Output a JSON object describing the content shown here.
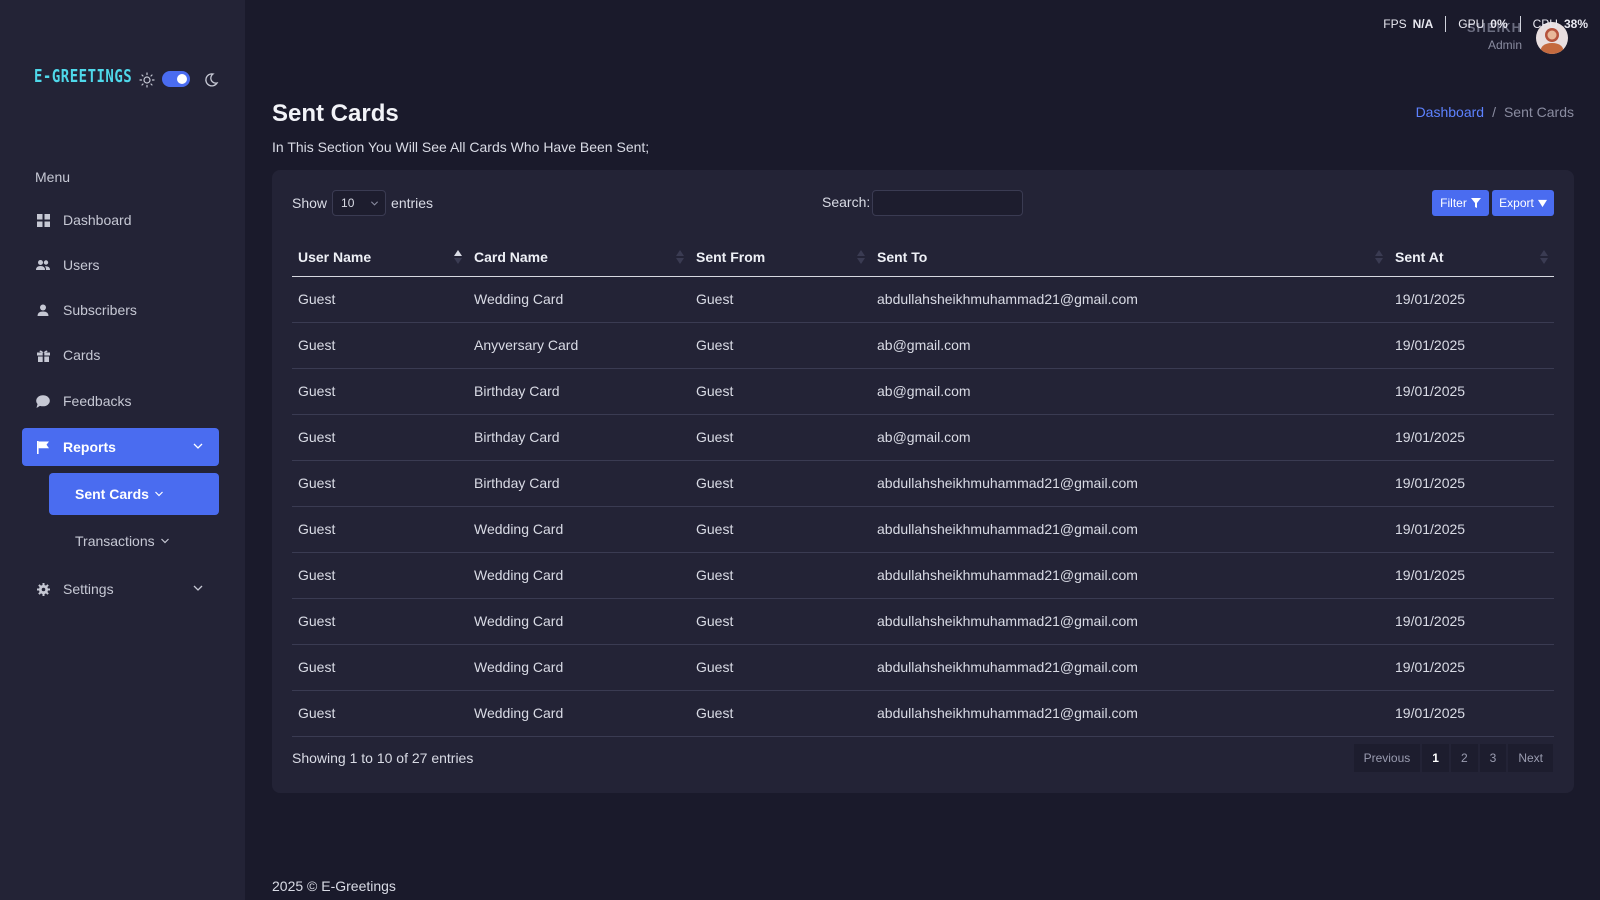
{
  "app": {
    "logo_text": "E-GREETINGS",
    "accent_color": "#4a6cf0"
  },
  "system_stats": {
    "fps_label": "FPS",
    "fps_value": "N/A",
    "gpu_label": "GPU",
    "gpu_value": "0%",
    "cpu_label": "CPU",
    "cpu_value": "38%"
  },
  "user": {
    "name": "SHEIKH",
    "role": "Admin"
  },
  "sidebar": {
    "menu_title": "Menu",
    "items": [
      {
        "label": "Dashboard",
        "icon": "grid-icon"
      },
      {
        "label": "Users",
        "icon": "users-icon"
      },
      {
        "label": "Subscribers",
        "icon": "user-icon"
      },
      {
        "label": "Cards",
        "icon": "gift-icon"
      },
      {
        "label": "Feedbacks",
        "icon": "chat-icon"
      },
      {
        "label": "Reports",
        "icon": "flag-icon",
        "active": true
      },
      {
        "label": "Settings",
        "icon": "gear-icon"
      }
    ],
    "sub_items": [
      {
        "label": "Sent Cards",
        "active": true
      },
      {
        "label": "Transactions",
        "active": false
      }
    ]
  },
  "page": {
    "title": "Sent Cards",
    "subtitle": "In This Section You Will See All Cards Who Have Been Sent;",
    "breadcrumb": {
      "home": "Dashboard",
      "separator": "/",
      "current": "Sent Cards"
    }
  },
  "table_controls": {
    "show_label": "Show",
    "entries_value": "10",
    "entries_label": "entries",
    "search_label": "Search:",
    "search_value": "",
    "filter_label": "Filter",
    "export_label": "Export"
  },
  "table": {
    "columns": [
      "User Name",
      "Card Name",
      "Sent From",
      "Sent To",
      "Sent At"
    ],
    "rows": [
      [
        "Guest",
        "Wedding Card",
        "Guest",
        "abdullahsheikhmuhammad21@gmail.com",
        "19/01/2025"
      ],
      [
        "Guest",
        "Anyversary Card",
        "Guest",
        "ab@gmail.com",
        "19/01/2025"
      ],
      [
        "Guest",
        "Birthday Card",
        "Guest",
        "ab@gmail.com",
        "19/01/2025"
      ],
      [
        "Guest",
        "Birthday Card",
        "Guest",
        "ab@gmail.com",
        "19/01/2025"
      ],
      [
        "Guest",
        "Birthday Card",
        "Guest",
        "abdullahsheikhmuhammad21@gmail.com",
        "19/01/2025"
      ],
      [
        "Guest",
        "Wedding Card",
        "Guest",
        "abdullahsheikhmuhammad21@gmail.com",
        "19/01/2025"
      ],
      [
        "Guest",
        "Wedding Card",
        "Guest",
        "abdullahsheikhmuhammad21@gmail.com",
        "19/01/2025"
      ],
      [
        "Guest",
        "Wedding Card",
        "Guest",
        "abdullahsheikhmuhammad21@gmail.com",
        "19/01/2025"
      ],
      [
        "Guest",
        "Wedding Card",
        "Guest",
        "abdullahsheikhmuhammad21@gmail.com",
        "19/01/2025"
      ],
      [
        "Guest",
        "Wedding Card",
        "Guest",
        "abdullahsheikhmuhammad21@gmail.com",
        "19/01/2025"
      ]
    ],
    "info": "Showing 1 to 10 of 27 entries"
  },
  "pagination": {
    "previous": "Previous",
    "pages": [
      "1",
      "2",
      "3"
    ],
    "current": "1",
    "next": "Next"
  },
  "footer": {
    "text": "2025 © E-Greetings"
  }
}
